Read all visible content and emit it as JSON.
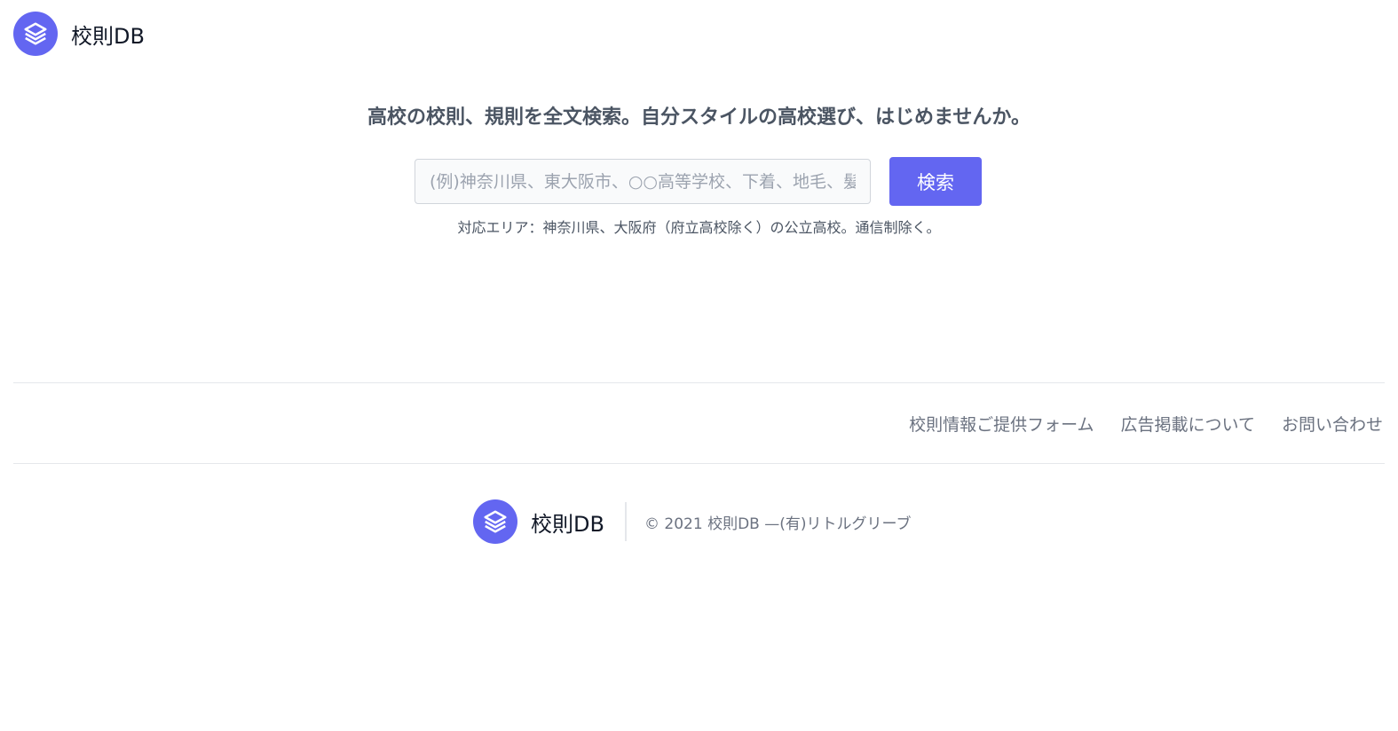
{
  "header": {
    "logo_text": "校則DB"
  },
  "hero": {
    "tagline": "高校の校則、規則を全文検索。自分スタイルの高校選び、はじめませんか。",
    "search_placeholder": "(例)神奈川県、東大阪市、○○高等学校、下着、地毛、髪型",
    "search_button": "検索",
    "coverage_note": "対応エリア：神奈川県、大阪府（府立高校除く）の公立高校。通信制除く。"
  },
  "footer": {
    "links": [
      "校則情報ご提供フォーム",
      "広告掲載について",
      "お問い合わせ"
    ],
    "logo_text": "校則DB",
    "copyright": "© 2021 校則DB —(有)リトルグリーブ"
  },
  "colors": {
    "accent": "#6366f1"
  }
}
